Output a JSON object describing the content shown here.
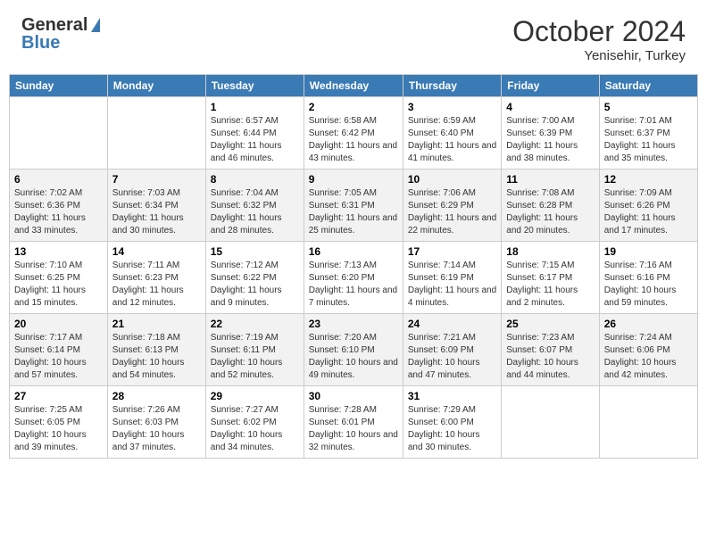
{
  "header": {
    "logo_general": "General",
    "logo_blue": "Blue",
    "month": "October 2024",
    "location": "Yenisehir, Turkey"
  },
  "days_of_week": [
    "Sunday",
    "Monday",
    "Tuesday",
    "Wednesday",
    "Thursday",
    "Friday",
    "Saturday"
  ],
  "weeks": [
    [
      {
        "day": "",
        "sunrise": "",
        "sunset": "",
        "daylight": ""
      },
      {
        "day": "",
        "sunrise": "",
        "sunset": "",
        "daylight": ""
      },
      {
        "day": "1",
        "sunrise": "Sunrise: 6:57 AM",
        "sunset": "Sunset: 6:44 PM",
        "daylight": "Daylight: 11 hours and 46 minutes."
      },
      {
        "day": "2",
        "sunrise": "Sunrise: 6:58 AM",
        "sunset": "Sunset: 6:42 PM",
        "daylight": "Daylight: 11 hours and 43 minutes."
      },
      {
        "day": "3",
        "sunrise": "Sunrise: 6:59 AM",
        "sunset": "Sunset: 6:40 PM",
        "daylight": "Daylight: 11 hours and 41 minutes."
      },
      {
        "day": "4",
        "sunrise": "Sunrise: 7:00 AM",
        "sunset": "Sunset: 6:39 PM",
        "daylight": "Daylight: 11 hours and 38 minutes."
      },
      {
        "day": "5",
        "sunrise": "Sunrise: 7:01 AM",
        "sunset": "Sunset: 6:37 PM",
        "daylight": "Daylight: 11 hours and 35 minutes."
      }
    ],
    [
      {
        "day": "6",
        "sunrise": "Sunrise: 7:02 AM",
        "sunset": "Sunset: 6:36 PM",
        "daylight": "Daylight: 11 hours and 33 minutes."
      },
      {
        "day": "7",
        "sunrise": "Sunrise: 7:03 AM",
        "sunset": "Sunset: 6:34 PM",
        "daylight": "Daylight: 11 hours and 30 minutes."
      },
      {
        "day": "8",
        "sunrise": "Sunrise: 7:04 AM",
        "sunset": "Sunset: 6:32 PM",
        "daylight": "Daylight: 11 hours and 28 minutes."
      },
      {
        "day": "9",
        "sunrise": "Sunrise: 7:05 AM",
        "sunset": "Sunset: 6:31 PM",
        "daylight": "Daylight: 11 hours and 25 minutes."
      },
      {
        "day": "10",
        "sunrise": "Sunrise: 7:06 AM",
        "sunset": "Sunset: 6:29 PM",
        "daylight": "Daylight: 11 hours and 22 minutes."
      },
      {
        "day": "11",
        "sunrise": "Sunrise: 7:08 AM",
        "sunset": "Sunset: 6:28 PM",
        "daylight": "Daylight: 11 hours and 20 minutes."
      },
      {
        "day": "12",
        "sunrise": "Sunrise: 7:09 AM",
        "sunset": "Sunset: 6:26 PM",
        "daylight": "Daylight: 11 hours and 17 minutes."
      }
    ],
    [
      {
        "day": "13",
        "sunrise": "Sunrise: 7:10 AM",
        "sunset": "Sunset: 6:25 PM",
        "daylight": "Daylight: 11 hours and 15 minutes."
      },
      {
        "day": "14",
        "sunrise": "Sunrise: 7:11 AM",
        "sunset": "Sunset: 6:23 PM",
        "daylight": "Daylight: 11 hours and 12 minutes."
      },
      {
        "day": "15",
        "sunrise": "Sunrise: 7:12 AM",
        "sunset": "Sunset: 6:22 PM",
        "daylight": "Daylight: 11 hours and 9 minutes."
      },
      {
        "day": "16",
        "sunrise": "Sunrise: 7:13 AM",
        "sunset": "Sunset: 6:20 PM",
        "daylight": "Daylight: 11 hours and 7 minutes."
      },
      {
        "day": "17",
        "sunrise": "Sunrise: 7:14 AM",
        "sunset": "Sunset: 6:19 PM",
        "daylight": "Daylight: 11 hours and 4 minutes."
      },
      {
        "day": "18",
        "sunrise": "Sunrise: 7:15 AM",
        "sunset": "Sunset: 6:17 PM",
        "daylight": "Daylight: 11 hours and 2 minutes."
      },
      {
        "day": "19",
        "sunrise": "Sunrise: 7:16 AM",
        "sunset": "Sunset: 6:16 PM",
        "daylight": "Daylight: 10 hours and 59 minutes."
      }
    ],
    [
      {
        "day": "20",
        "sunrise": "Sunrise: 7:17 AM",
        "sunset": "Sunset: 6:14 PM",
        "daylight": "Daylight: 10 hours and 57 minutes."
      },
      {
        "day": "21",
        "sunrise": "Sunrise: 7:18 AM",
        "sunset": "Sunset: 6:13 PM",
        "daylight": "Daylight: 10 hours and 54 minutes."
      },
      {
        "day": "22",
        "sunrise": "Sunrise: 7:19 AM",
        "sunset": "Sunset: 6:11 PM",
        "daylight": "Daylight: 10 hours and 52 minutes."
      },
      {
        "day": "23",
        "sunrise": "Sunrise: 7:20 AM",
        "sunset": "Sunset: 6:10 PM",
        "daylight": "Daylight: 10 hours and 49 minutes."
      },
      {
        "day": "24",
        "sunrise": "Sunrise: 7:21 AM",
        "sunset": "Sunset: 6:09 PM",
        "daylight": "Daylight: 10 hours and 47 minutes."
      },
      {
        "day": "25",
        "sunrise": "Sunrise: 7:23 AM",
        "sunset": "Sunset: 6:07 PM",
        "daylight": "Daylight: 10 hours and 44 minutes."
      },
      {
        "day": "26",
        "sunrise": "Sunrise: 7:24 AM",
        "sunset": "Sunset: 6:06 PM",
        "daylight": "Daylight: 10 hours and 42 minutes."
      }
    ],
    [
      {
        "day": "27",
        "sunrise": "Sunrise: 7:25 AM",
        "sunset": "Sunset: 6:05 PM",
        "daylight": "Daylight: 10 hours and 39 minutes."
      },
      {
        "day": "28",
        "sunrise": "Sunrise: 7:26 AM",
        "sunset": "Sunset: 6:03 PM",
        "daylight": "Daylight: 10 hours and 37 minutes."
      },
      {
        "day": "29",
        "sunrise": "Sunrise: 7:27 AM",
        "sunset": "Sunset: 6:02 PM",
        "daylight": "Daylight: 10 hours and 34 minutes."
      },
      {
        "day": "30",
        "sunrise": "Sunrise: 7:28 AM",
        "sunset": "Sunset: 6:01 PM",
        "daylight": "Daylight: 10 hours and 32 minutes."
      },
      {
        "day": "31",
        "sunrise": "Sunrise: 7:29 AM",
        "sunset": "Sunset: 6:00 PM",
        "daylight": "Daylight: 10 hours and 30 minutes."
      },
      {
        "day": "",
        "sunrise": "",
        "sunset": "",
        "daylight": ""
      },
      {
        "day": "",
        "sunrise": "",
        "sunset": "",
        "daylight": ""
      }
    ]
  ]
}
